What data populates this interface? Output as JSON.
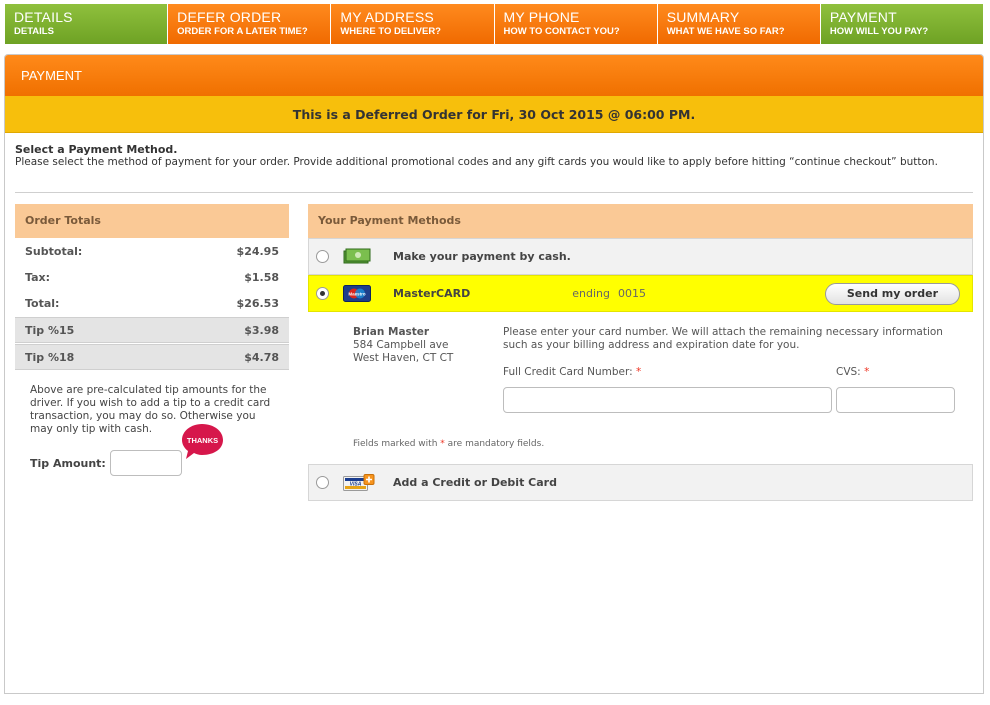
{
  "steps": [
    {
      "title": "DETAILS",
      "subtitle": "DETAILS",
      "color": "#7cb230"
    },
    {
      "title": "DEFER ORDER",
      "subtitle": "ORDER FOR A LATER TIME?",
      "color": "#f57a10"
    },
    {
      "title": "MY ADDRESS",
      "subtitle": "WHERE TO DELIVER?",
      "color": "#f57a10"
    },
    {
      "title": "MY PHONE",
      "subtitle": "HOW TO CONTACT YOU?",
      "color": "#f57a10"
    },
    {
      "title": "SUMMARY",
      "subtitle": "WHAT WE HAVE SO FAR?",
      "color": "#f57a10"
    },
    {
      "title": "PAYMENT",
      "subtitle": "HOW WILL YOU PAY?",
      "color": "#7cb230"
    }
  ],
  "panel": {
    "title": "PAYMENT",
    "deferred_notice": "This is a Deferred Order for Fri, 30 Oct 2015 @ 06:00 PM."
  },
  "intro": {
    "heading": "Select a Payment Method.",
    "text": "Please select the method of payment for your order. Provide additional promotional codes and any gift cards you would like to apply before hitting “continue checkout” button."
  },
  "totals": {
    "heading": "Order Totals",
    "rows": [
      {
        "label": "Subtotal:",
        "value": "$24.95"
      },
      {
        "label": "Tax:",
        "value": "$1.58"
      },
      {
        "label": "Total:",
        "value": "$26.53"
      }
    ],
    "tips": [
      {
        "label": "Tip %15",
        "value": "$3.98"
      },
      {
        "label": "Tip %18",
        "value": "$4.78"
      }
    ],
    "tip_note": "Above are pre-calculated tip amounts for the driver. If you wish to add a tip to a credit card transaction, you may do so. Otherwise you may only tip with cash.",
    "tip_amount_label": "Tip Amount:",
    "thanks_label": "THANKS"
  },
  "methods": {
    "heading": "Your Payment Methods",
    "cash_label": "Make your payment by cash.",
    "card_name": "MasterCARD",
    "card_badge": "Maestro",
    "ending_label": "ending",
    "ending_number": "0015",
    "send_button": "Send my order",
    "address": {
      "name": "Brian Master",
      "line1": "584 Campbell ave",
      "line2": "West Haven, CT   CT"
    },
    "form_text": "Please enter your card number. We will attach the remaining necessary information such as your billing address and expiration date for you.",
    "cc_label": "Full Credit Card Number:",
    "cvs_label": "CVS:",
    "required_mark": "*",
    "mandatory_prefix": "Fields marked with",
    "mandatory_suffix": "are mandatory fields.",
    "add_card_label": "Add a Credit or Debit Card",
    "visa_badge": "VISA"
  }
}
